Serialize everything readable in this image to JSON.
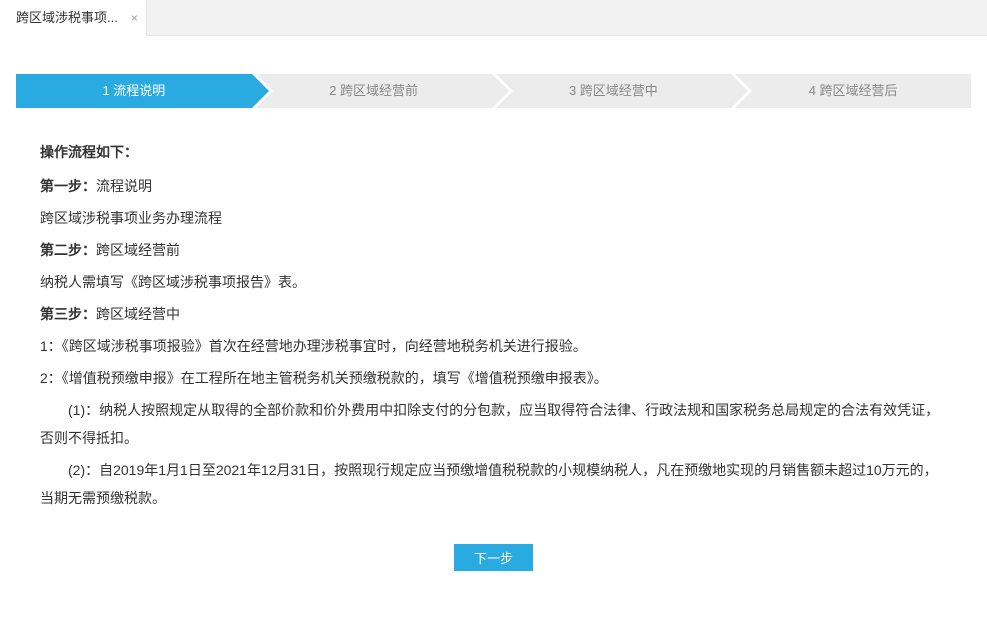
{
  "tab": {
    "label": "跨区域涉税事项...",
    "close": "×"
  },
  "steps": [
    {
      "num": "1",
      "label": "流程说明"
    },
    {
      "num": "2",
      "label": "跨区域经营前"
    },
    {
      "num": "3",
      "label": "跨区域经营中"
    },
    {
      "num": "4",
      "label": "跨区域经营后"
    }
  ],
  "content": {
    "headline": "操作流程如下：",
    "step1_h": "第一步：",
    "step1_t": "流程说明",
    "step1_body": "跨区域涉税事项业务办理流程",
    "step2_h": "第二步：",
    "step2_t": "跨区域经营前",
    "step2_body": "纳税人需填写《跨区域涉税事项报告》表。",
    "step3_h": "第三步：",
    "step3_t": "跨区域经营中",
    "step3_l1": "1：《跨区域涉税事项报验》首次在经营地办理涉税事宜时，向经营地税务机关进行报验。",
    "step3_l2": "2：《增值税预缴申报》在工程所在地主管税务机关预缴税款的，填写《增值税预缴申报表》。",
    "step3_s1": "　　(1)：纳税人按照规定从取得的全部价款和价外费用中扣除支付的分包款，应当取得符合法律、行政法规和国家税务总局规定的合法有效凭证，否则不得抵扣。",
    "step3_s2": "　　(2)：自2019年1月1日至2021年12月31日，按照现行规定应当预缴增值税税款的小规模纳税人，凡在预缴地实现的月销售额未超过10万元的，当期无需预缴税款。"
  },
  "buttons": {
    "next": "下一步"
  }
}
